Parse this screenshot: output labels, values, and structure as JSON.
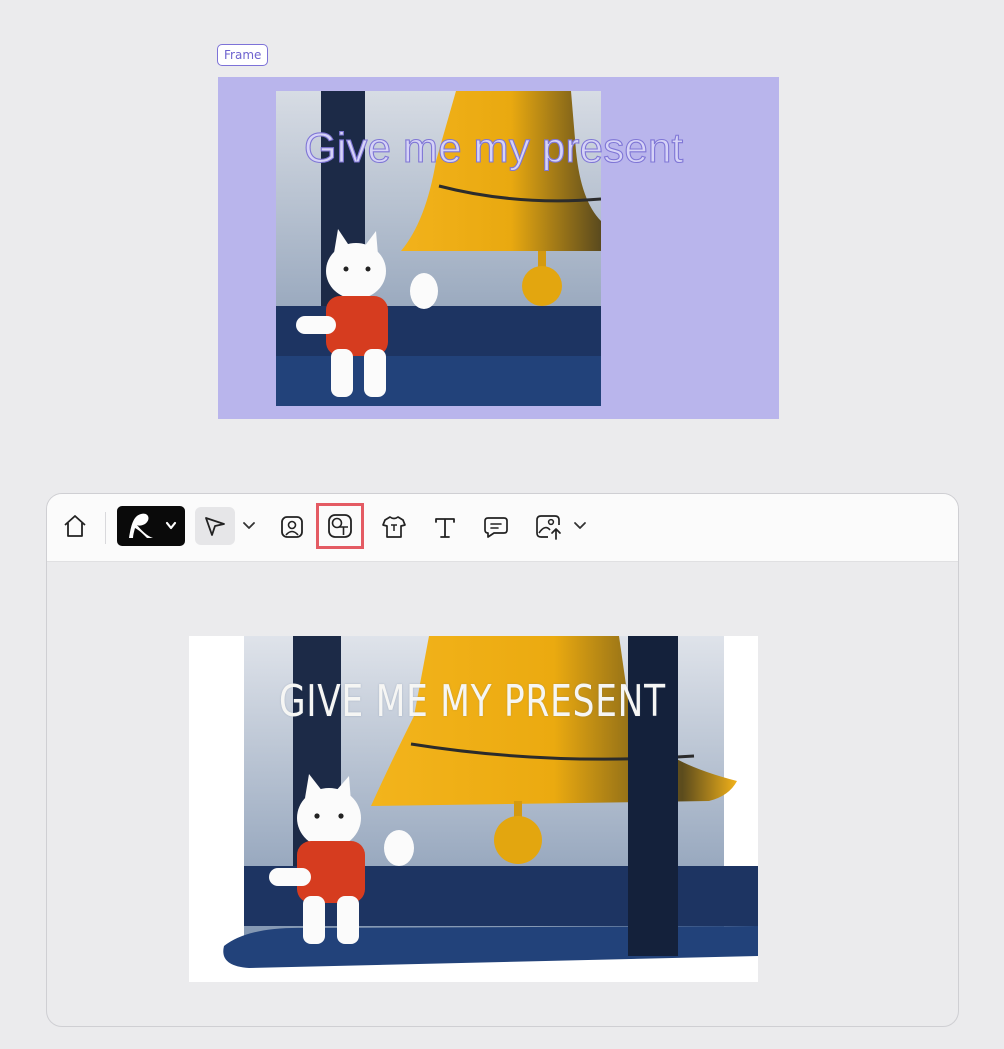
{
  "frame": {
    "label": "Frame",
    "background_color": "#b9b5ec",
    "heading": "Give me my present"
  },
  "toolbar": {
    "items": [
      {
        "name": "home",
        "icon": "home-icon"
      },
      {
        "name": "brand-menu",
        "icon": "brand-logo-icon"
      },
      {
        "name": "select-tool",
        "icon": "pointer-icon",
        "active": true
      },
      {
        "name": "image-tool",
        "icon": "image-icon"
      },
      {
        "name": "shape-text-tool",
        "icon": "shape-text-icon",
        "highlighted": true
      },
      {
        "name": "product-tool",
        "icon": "shirt-icon"
      },
      {
        "name": "text-tool",
        "icon": "text-icon"
      },
      {
        "name": "comment-tool",
        "icon": "comment-icon"
      },
      {
        "name": "upload-tool",
        "icon": "upload-image-icon"
      }
    ],
    "highlight_color": "#e45b63"
  },
  "canvas": {
    "heading": "GIVE ME MY PRESENT"
  }
}
